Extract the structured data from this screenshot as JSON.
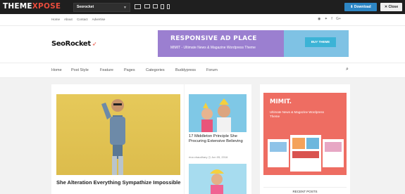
{
  "preview_bar": {
    "brand_a": "THEME",
    "brand_b": "XPOSE",
    "theme_selected": "Seorocket",
    "download_label": "Download",
    "close_label": "Close"
  },
  "topnav": {
    "links": [
      "Home",
      "About",
      "Contact",
      "Advertise"
    ]
  },
  "social_icons": [
    "rss-icon",
    "twitter-icon",
    "facebook-icon",
    "google-plus-icon"
  ],
  "logo": {
    "text": "SeoRocket"
  },
  "ad": {
    "title": "RESPONSIVE AD PLACE",
    "subtitle": "MIMIT - Ultimate News & Magazine Wordpress Theme",
    "button": "BUY THEME"
  },
  "nav": {
    "items": [
      "Home",
      "Post Style",
      "Feature",
      "Pages",
      "Categories",
      "Buddypress",
      "Forum"
    ]
  },
  "posts": {
    "main_title": "She Alteration Everything Sympathize Impossible",
    "mid_title": "17 Middleton Principle She Procuring Extensive Believing",
    "mid_meta": "rina chaudhary  ◷ Jun 05, 2016"
  },
  "sidebar": {
    "ad_title": "MIMIT.",
    "ad_sub": "Ultimate News & Magazine Wordpress Theme",
    "recent_posts": "RECENT POSTS"
  },
  "colors": {
    "preview_bar": "#1f1f1f",
    "accent": "#e74c3c",
    "download": "#2d86c4",
    "ad_purple": "#9b7fd0",
    "sidebar_ad": "#ee6d62"
  }
}
